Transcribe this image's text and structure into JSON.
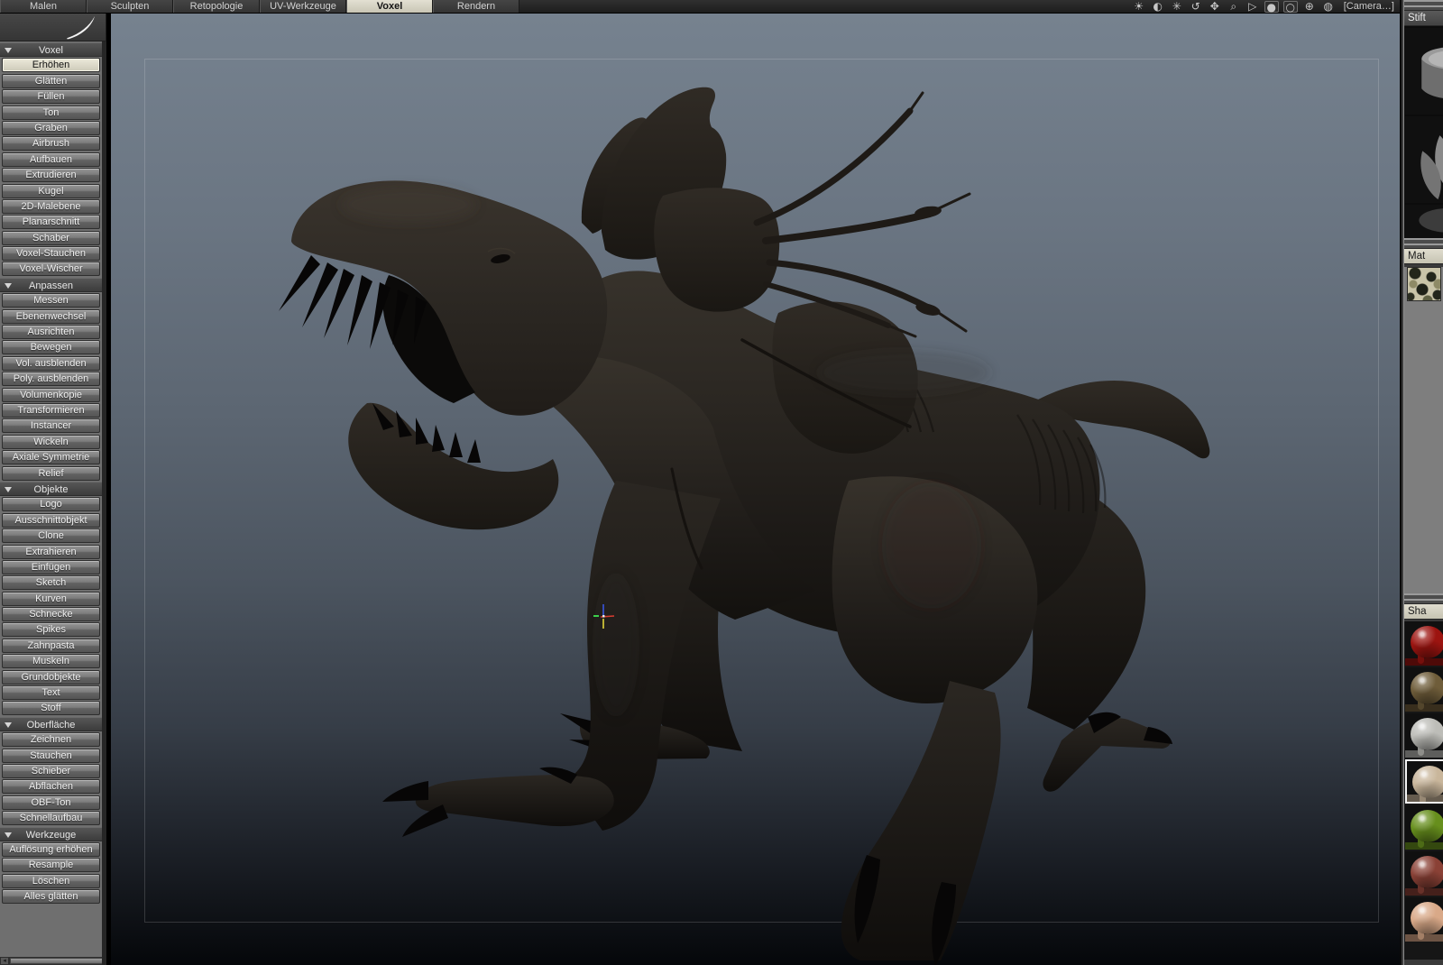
{
  "menubar": {
    "tabs": [
      {
        "label": "Malen",
        "active": false
      },
      {
        "label": "Sculpten",
        "active": false
      },
      {
        "label": "Retopologie",
        "active": false
      },
      {
        "label": "UV-Werkzeuge",
        "active": false
      },
      {
        "label": "Voxel",
        "active": true
      },
      {
        "label": "Rendern",
        "active": false
      }
    ],
    "view_icons": [
      {
        "name": "brightness-icon",
        "glyph": "☀",
        "boxed": false
      },
      {
        "name": "contrast-icon",
        "glyph": "◐",
        "boxed": false
      },
      {
        "name": "glare-icon",
        "glyph": "✳",
        "boxed": false
      },
      {
        "name": "rotate-view-icon",
        "glyph": "↺",
        "boxed": false
      },
      {
        "name": "pan-view-icon",
        "glyph": "✥",
        "boxed": false
      },
      {
        "name": "zoom-view-icon",
        "glyph": "⌕",
        "boxed": false
      },
      {
        "name": "pointer-mode-icon",
        "glyph": "▷",
        "boxed": false
      },
      {
        "name": "shaded-sphere-toggle-icon",
        "glyph": "●",
        "boxed": true
      },
      {
        "name": "wire-sphere-toggle-icon",
        "glyph": "○",
        "boxed": true
      },
      {
        "name": "focus-point-icon",
        "glyph": "⊕",
        "boxed": false
      },
      {
        "name": "trackball-icon",
        "glyph": "◍",
        "boxed": false
      }
    ],
    "camera_label": "[Camera…]"
  },
  "sidebar": {
    "sections": [
      {
        "title": "Voxel",
        "items": [
          {
            "label": "Erhöhen",
            "active": true
          },
          {
            "label": "Glätten"
          },
          {
            "label": "Füllen"
          },
          {
            "label": "Ton"
          },
          {
            "label": "Graben"
          },
          {
            "label": "Airbrush"
          },
          {
            "label": "Aufbauen"
          },
          {
            "label": "Extrudieren"
          },
          {
            "label": "Kugel"
          },
          {
            "label": "2D-Malebene"
          },
          {
            "label": "Planarschnitt"
          },
          {
            "label": "Schaber"
          },
          {
            "label": "Voxel-Stauchen"
          },
          {
            "label": "Voxel-Wischer"
          }
        ]
      },
      {
        "title": "Anpassen",
        "items": [
          {
            "label": "Messen"
          },
          {
            "label": "Ebenenwechsel"
          },
          {
            "label": "Ausrichten"
          },
          {
            "label": "Bewegen"
          },
          {
            "label": "Vol. ausblenden"
          },
          {
            "label": "Poly. ausblenden"
          },
          {
            "label": "Volumenkopie"
          },
          {
            "label": "Transformieren"
          },
          {
            "label": "Instancer"
          },
          {
            "label": "Wickeln"
          },
          {
            "label": "Axiale Symmetrie"
          },
          {
            "label": "Relief"
          }
        ]
      },
      {
        "title": "Objekte",
        "items": [
          {
            "label": "Logo"
          },
          {
            "label": "Ausschnittobjekt"
          },
          {
            "label": "Clone"
          },
          {
            "label": "Extrahieren"
          },
          {
            "label": "Einfügen"
          },
          {
            "label": "Sketch"
          },
          {
            "label": "Kurven"
          },
          {
            "label": "Schnecke"
          },
          {
            "label": "Spikes"
          },
          {
            "label": "Zahnpasta"
          },
          {
            "label": "Muskeln"
          },
          {
            "label": "Grundobjekte"
          },
          {
            "label": "Text"
          },
          {
            "label": "Stoff"
          }
        ]
      },
      {
        "title": "Oberfläche",
        "items": [
          {
            "label": "Zeichnen"
          },
          {
            "label": "Stauchen"
          },
          {
            "label": "Schieber"
          },
          {
            "label": "Abflachen"
          },
          {
            "label": "OBF-Ton"
          },
          {
            "label": "Schnellaufbau"
          }
        ]
      },
      {
        "title": "Werkzeuge",
        "items": [
          {
            "label": "Auflösung erhöhen"
          },
          {
            "label": "Resample"
          },
          {
            "label": "Löschen"
          },
          {
            "label": "Alles glätten"
          }
        ]
      }
    ]
  },
  "right_panels": {
    "pens": {
      "title": "Stift",
      "thumbs": [
        {
          "name": "pen-preview-cylinder",
          "kind": "cylinder"
        },
        {
          "name": "pen-preview-petals",
          "kind": "petals"
        },
        {
          "name": "pen-preview-dark",
          "kind": "dark"
        }
      ]
    },
    "materials": {
      "title": "Mat",
      "thumbs": [
        {
          "name": "material-camouflage"
        }
      ]
    },
    "shaders": {
      "title": "Sha",
      "items": [
        {
          "name": "shader-red-glossy",
          "color": "#9c1410",
          "selected": false
        },
        {
          "name": "shader-gold-stone",
          "color": "#6f5d3a",
          "selected": false
        },
        {
          "name": "shader-white-stone",
          "color": "#bdbdb8",
          "selected": false
        },
        {
          "name": "shader-clay-beige",
          "color": "#c9b69b",
          "selected": true
        },
        {
          "name": "shader-green",
          "color": "#678f1d",
          "selected": false
        },
        {
          "name": "shader-maroon",
          "color": "#8a4136",
          "selected": false
        },
        {
          "name": "shader-skin-peach",
          "color": "#d9a988",
          "selected": false
        }
      ]
    }
  },
  "colors": {
    "active_tab": "#d9d6c8",
    "viewport_top": "#76828f",
    "viewport_bottom": "#05070a",
    "sidebar_bg": "#6f6f6f",
    "model_body": "#2b2622"
  }
}
